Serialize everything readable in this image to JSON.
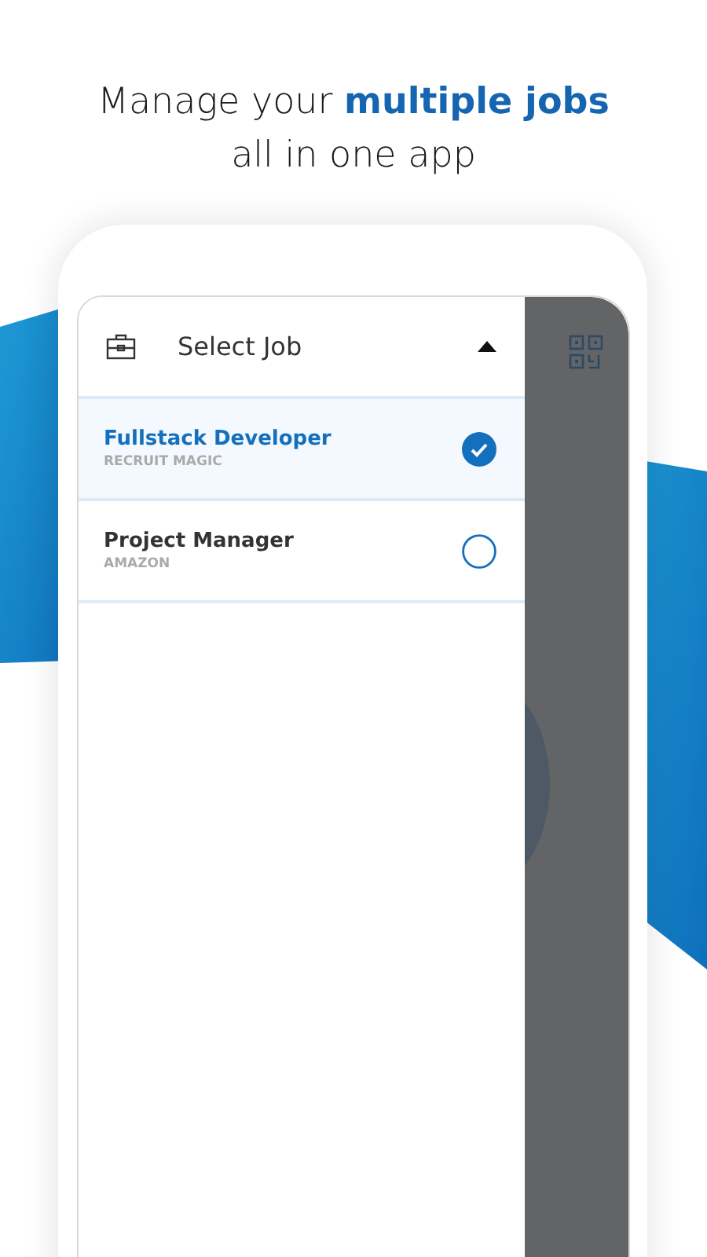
{
  "headline": {
    "line_1": "Manage your **multiple jobs**",
    "line_2": "all in one app"
  },
  "job_selector": {
    "title": "Select Job",
    "expanded": true
  },
  "jobs": [
    {
      "title": "Fullstack Developer",
      "company": "RECRUIT MAGIC",
      "selected": true
    },
    {
      "title": "Project Manager",
      "company": "AMAZON",
      "selected": false
    }
  ]
}
